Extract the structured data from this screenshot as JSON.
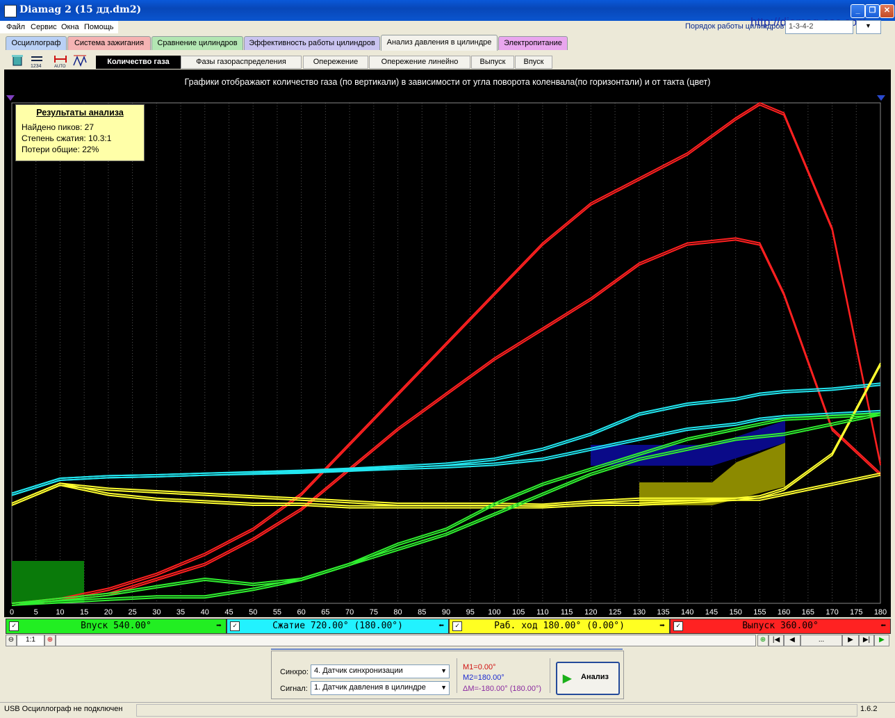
{
  "window": {
    "title": "Diamag 2 (15 дд.dm2)",
    "controls": [
      "_",
      "❐",
      "✕"
    ]
  },
  "menu": [
    "Файл",
    "Сервис",
    "Окна",
    "Помощь"
  ],
  "top_right": {
    "label": "Порядок работы цилиндров",
    "watermark": "http://diamag-osc.com",
    "combo_value": "1-3-4-2"
  },
  "main_tabs": [
    {
      "label": "Осциллограф",
      "color": "#b9d0f5"
    },
    {
      "label": "Система зажигания",
      "color": "#f5b3b3"
    },
    {
      "label": "Сравнение цилиндров",
      "color": "#b3e6b3"
    },
    {
      "label": "Эффективность работы цилиндров",
      "color": "#c9c3ef"
    },
    {
      "label": "Анализ давления в цилиндре",
      "color": "#f3f2ec"
    },
    {
      "label": "Электропитание",
      "color": "#e9a6ee"
    }
  ],
  "toolbar_icons": [
    "cylinder-icon",
    "cycle-counter-icon",
    "auto-scale-icon",
    "peak-detect-icon"
  ],
  "sub_tabs": [
    {
      "label": "Количество газа"
    },
    {
      "label": "Фазы газораспределения"
    },
    {
      "label": "Опережение"
    },
    {
      "label": "Опережение линейно"
    },
    {
      "label": "Выпуск"
    },
    {
      "label": "Впуск"
    }
  ],
  "plot": {
    "caption": "Графики отображают количество газа (по вертикали) в зависимости от угла поворота коленвала(по горизонтали) и от такта (цвет)",
    "results": {
      "title": "Результаты анализа",
      "peaks": "Найдено пиков: 27",
      "compression": "Степень сжатия: 10.3:1",
      "losses": "Потери общие: 22%"
    },
    "x_ticks": [
      "0",
      "5",
      "10",
      "15",
      "20",
      "25",
      "30",
      "35",
      "40",
      "45",
      "50",
      "55",
      "60",
      "65",
      "70",
      "75",
      "80",
      "85",
      "90",
      "95",
      "100",
      "105",
      "110",
      "115",
      "120",
      "125",
      "130",
      "135",
      "140",
      "145",
      "150",
      "155",
      "160",
      "165",
      "170",
      "175",
      "180"
    ]
  },
  "chart_data": {
    "type": "line",
    "x": [
      0,
      10,
      20,
      30,
      40,
      50,
      60,
      70,
      80,
      90,
      100,
      110,
      120,
      130,
      140,
      150,
      155,
      160,
      170,
      180
    ],
    "xlim": [
      0,
      180
    ],
    "ylim": [
      0,
      100
    ],
    "grid": true,
    "series": [
      {
        "color": "#ff2020",
        "values": [
          0,
          1,
          3,
          6,
          10,
          15,
          22,
          32,
          42,
          52,
          62,
          72,
          80,
          85,
          90,
          97,
          100,
          98,
          75,
          28
        ]
      },
      {
        "color": "#ff2020",
        "values": [
          0,
          1,
          2,
          5,
          8,
          13,
          19,
          27,
          35,
          42,
          49,
          55,
          61,
          68,
          72,
          73,
          72,
          62,
          35,
          26
        ]
      },
      {
        "color": "#22e6f0",
        "values": [
          22,
          25,
          25.5,
          25.7,
          26,
          26.3,
          26.6,
          27,
          27.5,
          28,
          29,
          31,
          34,
          38,
          40,
          41,
          42,
          42.5,
          43,
          44
        ]
      },
      {
        "color": "#22e6f0",
        "values": [
          22,
          25,
          25.5,
          25.7,
          26,
          26.2,
          26.4,
          26.8,
          27.2,
          27.5,
          28,
          29,
          31,
          33,
          35,
          36,
          37,
          37.5,
          38,
          38.5
        ]
      },
      {
        "color": "#ffff30",
        "values": [
          20,
          24,
          23,
          22.5,
          22,
          21.5,
          21,
          20.5,
          20,
          20,
          20,
          19.8,
          20.5,
          21,
          21,
          21,
          21.5,
          23,
          30,
          48
        ]
      },
      {
        "color": "#ffff30",
        "values": [
          20,
          24,
          22,
          21,
          20.5,
          20,
          20,
          19.5,
          19.5,
          19.5,
          19.5,
          19.5,
          20,
          20,
          20.5,
          21,
          21,
          22,
          24,
          26
        ]
      },
      {
        "color": "#30f030",
        "values": [
          0,
          1,
          2,
          3.5,
          5,
          4,
          5,
          8,
          12,
          15,
          20,
          24,
          27,
          30,
          33,
          35,
          36,
          37,
          37.5,
          38
        ]
      },
      {
        "color": "#30f030",
        "values": [
          0,
          0.5,
          1,
          1.5,
          1.5,
          3,
          5,
          8,
          11,
          14,
          18,
          22,
          26,
          29,
          31,
          33,
          33.5,
          34,
          36,
          38
        ]
      }
    ]
  },
  "phases": [
    {
      "label": "Впуск 540.00°",
      "color": "#22ee22",
      "arrow": "➡"
    },
    {
      "label": "Сжатие 720.00° (180.00°)",
      "color": "#22f2ff",
      "arrow": "⬅"
    },
    {
      "label": "Раб. ход 180.00° (0.00°)",
      "color": "#ffff22",
      "arrow": "➡"
    },
    {
      "label": "Выпуск 360.00°",
      "color": "#ff2222",
      "arrow": "⬅"
    }
  ],
  "zoom": "1:1",
  "nav_dots": "...",
  "bottom": {
    "sync_label": "Синхро:",
    "sync_value": "4.  Датчик синхронизации",
    "signal_label": "Сигнал:",
    "signal_value": "1.  Датчик давления в цилиндре",
    "m1": "M1=0.00°",
    "m2": "M2=180.00°",
    "dm": "ΔM=-180.00° (180.00°)",
    "analysis_button": "Анализ"
  },
  "status": {
    "left": "USB Осциллограф не подключен",
    "version": "1.6.2"
  }
}
